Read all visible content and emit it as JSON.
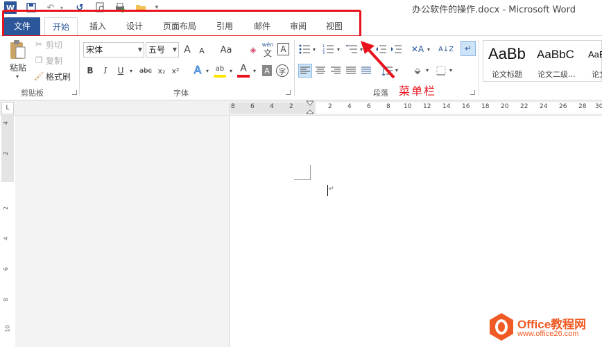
{
  "window": {
    "title": "办公软件的操作.docx - Microsoft Word"
  },
  "quick_access": {
    "word_icon": "W",
    "save_icon": "save-icon",
    "undo_icon": "↶",
    "redo_icon": "↺",
    "preview_icon": "print-preview-icon",
    "more_icon": "▾"
  },
  "tabs": [
    {
      "label": "文件"
    },
    {
      "label": "开始"
    },
    {
      "label": "插入"
    },
    {
      "label": "设计"
    },
    {
      "label": "页面布局"
    },
    {
      "label": "引用"
    },
    {
      "label": "邮件"
    },
    {
      "label": "审阅"
    },
    {
      "label": "视图"
    }
  ],
  "ribbon": {
    "clipboard": {
      "paste": "粘贴",
      "cut": "剪切",
      "copy": "复制",
      "format_painter": "格式刷",
      "group_label": "剪贴板"
    },
    "font": {
      "font_name": "宋体",
      "font_size": "五号",
      "grow": "A",
      "shrink": "A",
      "change_case": "Aa",
      "clear_format": "◈",
      "phonetic": "wén",
      "phonetic_sub": "文",
      "border": "A",
      "bold": "B",
      "italic": "I",
      "underline": "U",
      "strike": "abc",
      "subscript": "x₂",
      "superscript": "x²",
      "text_effects": "A",
      "highlight": "ab",
      "font_color": "A",
      "char_shading": "A",
      "enclose": "字",
      "group_label": "字体"
    },
    "paragraph": {
      "group_label": "段落"
    },
    "styles": [
      {
        "preview": "AaBb",
        "name": "论文标题"
      },
      {
        "preview": "AaBbC",
        "name": "论文二级..."
      },
      {
        "preview": "AaB",
        "name": "论文"
      }
    ]
  },
  "annotation": {
    "text": "菜单栏",
    "color": "#e8121d"
  },
  "ruler": {
    "horizontal": [
      "8",
      "6",
      "4",
      "2",
      "2",
      "4",
      "6",
      "8",
      "10",
      "12",
      "14",
      "16",
      "18",
      "20",
      "22",
      "24",
      "26",
      "28",
      "30"
    ],
    "vertical": [
      "4",
      "2",
      "2",
      "4",
      "6",
      "8",
      "10"
    ],
    "corner": "L"
  },
  "watermark": {
    "title": "Office教程网",
    "url": "www.office26.com"
  },
  "colors": {
    "file_tab": "#2b579a",
    "active_tab_text": "#2b579a",
    "highlight_box": "#e8121d",
    "watermark": "#f05a24"
  }
}
